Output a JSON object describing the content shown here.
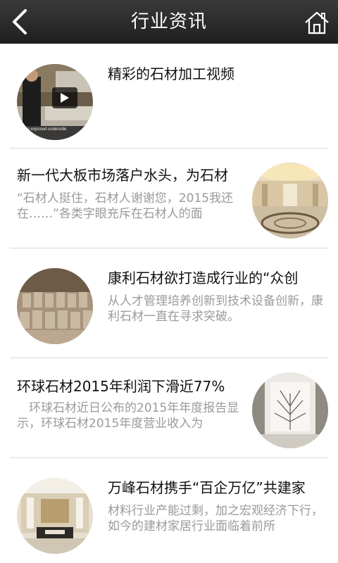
{
  "header": {
    "title": "行业资讯",
    "back_icon": "chevron-left-icon",
    "home_icon": "home-icon"
  },
  "articles": [
    {
      "title": "精彩的石材加工视频",
      "summary": "",
      "image_position": "left",
      "image_caption": "ing exposed underside"
    },
    {
      "title": "新一代大板市场落户水头，为石材",
      "summary": "“石材人挺住，石材人谢谢您，2015我还在……”各类字眼充斥在石材人的面",
      "image_position": "right"
    },
    {
      "title": "康利石材欲打造成行业的“众创",
      "summary": "从人才管理培养创新到技术设备创新，康利石材一直在寻求突破。",
      "image_position": "left"
    },
    {
      "title": "环球石材2015年利润下滑近77%",
      "summary": "　环球石材近日公布的2015年年度报告显示，环球石材2015年度营业收入为",
      "image_position": "right"
    },
    {
      "title": "万峰石材携手“百企万亿”共建家",
      "summary": "材料行业产能过剩，加之宏观经济下行，如今的建材家居行业面临着前所",
      "image_position": "left"
    }
  ]
}
